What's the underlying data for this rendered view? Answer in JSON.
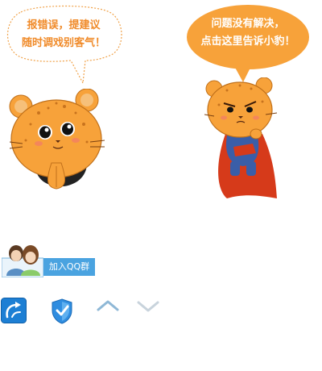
{
  "bubbles": {
    "report": {
      "line1": "报错误，提建议",
      "line2": "随时调戏别客气！"
    },
    "help": {
      "line1": "问题没有解决，",
      "line2": "点击这里告诉小豹！"
    }
  },
  "group": {
    "button_label": "加入QQ群"
  },
  "colors": {
    "orange_text": "#f08b2a",
    "orange_fill": "#f7a23a",
    "blue_button": "#4aa3e0",
    "arrow_up": "#8fb8d6",
    "arrow_down": "#c8d3dc"
  },
  "icons": {
    "share": "share-icon",
    "security": "shield-check-icon",
    "up": "chevron-up-icon",
    "down": "chevron-down-icon"
  }
}
